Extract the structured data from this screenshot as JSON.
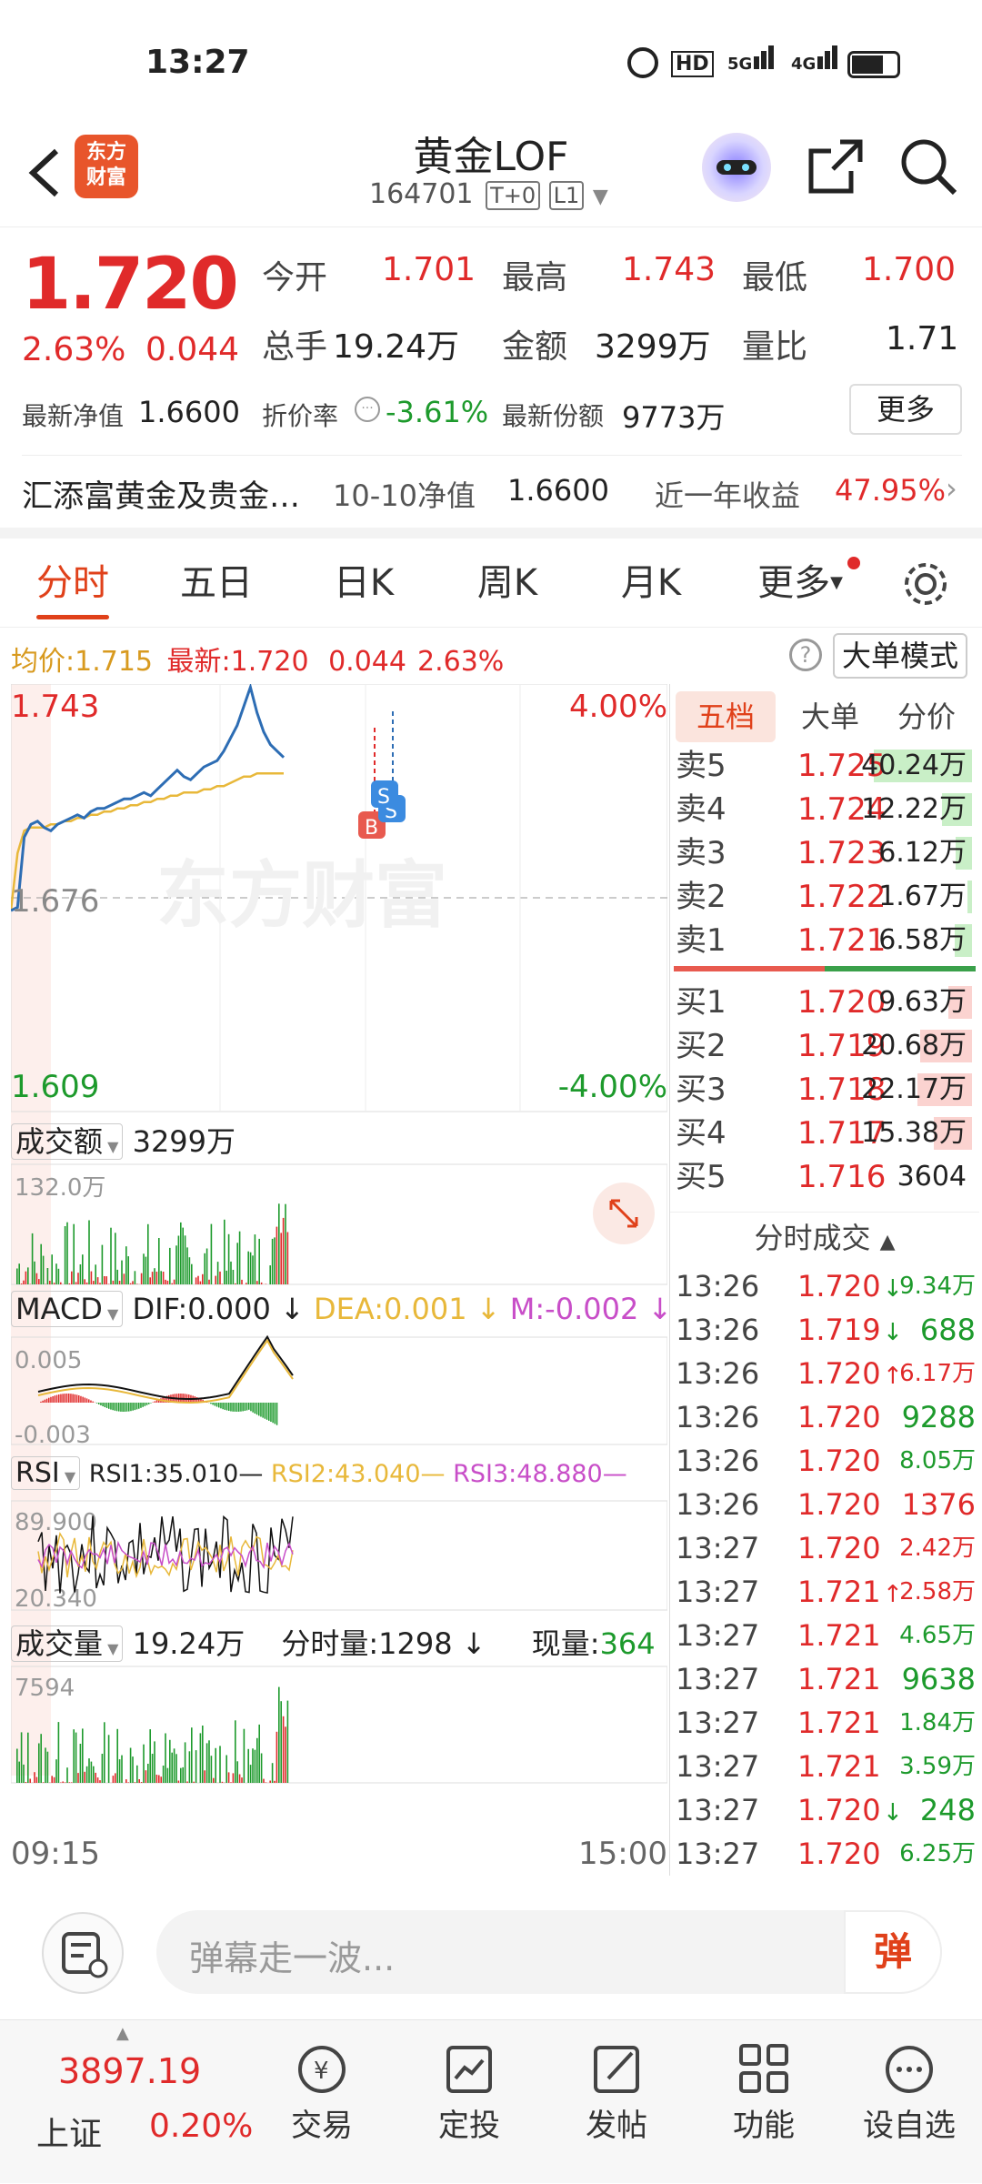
{
  "status": {
    "time": "13:27",
    "net_badge": "HD",
    "sig1": "5G",
    "sig2": "4G"
  },
  "nav": {
    "logo_line1": "东方",
    "logo_line2": "财富",
    "title": "黄金LOF",
    "code": "164701",
    "tag1": "T+0",
    "tag2": "L1"
  },
  "quote": {
    "price": "1.720",
    "pct": "2.63%",
    "chg": "0.044",
    "row1": [
      {
        "label": "今开",
        "value": "1.701"
      },
      {
        "label": "最高",
        "value": "1.743"
      },
      {
        "label": "最低",
        "value": "1.700"
      }
    ],
    "row2": [
      {
        "label": "总手",
        "value": "19.24万"
      },
      {
        "label": "金额",
        "value": "3299万"
      },
      {
        "label": "量比",
        "value": "1.71"
      }
    ],
    "nav_label": "最新净值",
    "nav_value": "1.6600",
    "discount_label": "折价率",
    "discount_value": "-3.61%",
    "share_label": "最新份额",
    "share_value": "9773万",
    "more": "更多",
    "fund_name": "汇添富黄金及贵金…",
    "nav_date_label": "10-10净值",
    "nav_date_value": "1.6600",
    "yield_label": "近一年收益",
    "yield_value": "47.95%"
  },
  "tabs": [
    "分时",
    "五日",
    "日K",
    "周K",
    "月K",
    "更多"
  ],
  "info_bar": {
    "avg_label": "均价:",
    "avg": "1.715",
    "latest_label": "最新:",
    "latest": "1.720",
    "chg": "0.044",
    "pct": "2.63%",
    "mode_btn": "大单模式"
  },
  "chart": {
    "ymax": "1.743",
    "ymid": "1.676",
    "ymin": "1.609",
    "pmax": "4.00%",
    "pmin": "-4.00%",
    "marker_b": "B",
    "marker_s": "S",
    "watermark": "东方财富",
    "price_series": [
      1.672,
      1.673,
      1.695,
      1.699,
      1.7,
      1.698,
      1.697,
      1.699,
      1.7,
      1.701,
      1.702,
      1.701,
      1.703,
      1.704,
      1.704,
      1.705,
      1.706,
      1.707,
      1.707,
      1.708,
      1.709,
      1.708,
      1.71,
      1.712,
      1.714,
      1.716,
      1.714,
      1.713,
      1.715,
      1.717,
      1.718,
      1.719,
      1.722,
      1.726,
      1.73,
      1.736,
      1.742,
      1.734,
      1.728,
      1.724,
      1.722,
      1.72
    ],
    "avg_series": [
      1.672,
      1.69,
      1.697,
      1.698,
      1.698,
      1.698,
      1.699,
      1.699,
      1.7,
      1.7,
      1.701,
      1.701,
      1.702,
      1.702,
      1.703,
      1.703,
      1.704,
      1.704,
      1.705,
      1.705,
      1.706,
      1.706,
      1.707,
      1.707,
      1.708,
      1.708,
      1.709,
      1.709,
      1.709,
      1.71,
      1.71,
      1.711,
      1.711,
      1.712,
      1.713,
      1.714,
      1.714,
      1.715,
      1.715,
      1.715,
      1.715,
      1.715
    ]
  },
  "turnover": {
    "label": "成交额",
    "value": "3299万",
    "axis_max": "132.0万"
  },
  "macd": {
    "label": "MACD",
    "dif": "DIF:0.000",
    "dea": "DEA:0.001",
    "m": "M:-0.002",
    "ymax": "0.005",
    "ymin": "-0.003"
  },
  "rsi": {
    "label": "RSI",
    "rsi1": "RSI1:35.010",
    "rsi2": "RSI2:43.040",
    "rsi3": "RSI3:48.880",
    "ymax": "89.900",
    "ymin": "20.340"
  },
  "volume": {
    "label": "成交量",
    "value": "19.24万",
    "fs_label": "分时量:1298",
    "now_label": "现量:",
    "now_value": "364",
    "axis_max": "7594"
  },
  "time_axis": {
    "start": "09:15",
    "end": "15:00"
  },
  "book": {
    "tabs": [
      "五档",
      "大单",
      "分价"
    ],
    "sells": [
      {
        "label": "卖5",
        "price": "1.725",
        "vol": "40.24万",
        "fill": 0.98
      },
      {
        "label": "卖4",
        "price": "1.724",
        "vol": "12.22万",
        "fill": 0.3
      },
      {
        "label": "卖3",
        "price": "1.723",
        "vol": "6.12万",
        "fill": 0.16
      },
      {
        "label": "卖2",
        "price": "1.722",
        "vol": "1.67万",
        "fill": 0.05
      },
      {
        "label": "卖1",
        "price": "1.721",
        "vol": "6.58万",
        "fill": 0.17
      }
    ],
    "buys": [
      {
        "label": "买1",
        "price": "1.720",
        "vol": "9.63万",
        "fill": 0.24
      },
      {
        "label": "买2",
        "price": "1.719",
        "vol": "20.68万",
        "fill": 0.52
      },
      {
        "label": "买3",
        "price": "1.718",
        "vol": "22.17万",
        "fill": 0.55
      },
      {
        "label": "买4",
        "price": "1.717",
        "vol": "15.38万",
        "fill": 0.38
      },
      {
        "label": "买5",
        "price": "1.716",
        "vol": "3604",
        "fill": 0.0
      }
    ]
  },
  "trades_title": "分时成交",
  "trades": [
    {
      "t": "13:26",
      "p": "1.720",
      "dir": "down",
      "v": "9.34万",
      "vc": "green"
    },
    {
      "t": "13:26",
      "p": "1.719",
      "dir": "down",
      "v": "688",
      "vc": "green"
    },
    {
      "t": "13:26",
      "p": "1.720",
      "dir": "up",
      "v": "6.17万",
      "vc": "red"
    },
    {
      "t": "13:26",
      "p": "1.720",
      "dir": "",
      "v": "9288",
      "vc": "green"
    },
    {
      "t": "13:26",
      "p": "1.720",
      "dir": "",
      "v": "8.05万",
      "vc": "green"
    },
    {
      "t": "13:26",
      "p": "1.720",
      "dir": "",
      "v": "1376",
      "vc": "red"
    },
    {
      "t": "13:27",
      "p": "1.720",
      "dir": "",
      "v": "2.42万",
      "vc": "red"
    },
    {
      "t": "13:27",
      "p": "1.721",
      "dir": "up",
      "v": "2.58万",
      "vc": "red"
    },
    {
      "t": "13:27",
      "p": "1.721",
      "dir": "",
      "v": "4.65万",
      "vc": "green"
    },
    {
      "t": "13:27",
      "p": "1.721",
      "dir": "",
      "v": "9638",
      "vc": "green"
    },
    {
      "t": "13:27",
      "p": "1.721",
      "dir": "",
      "v": "1.84万",
      "vc": "green"
    },
    {
      "t": "13:27",
      "p": "1.721",
      "dir": "",
      "v": "3.59万",
      "vc": "green"
    },
    {
      "t": "13:27",
      "p": "1.720",
      "dir": "down",
      "v": "248",
      "vc": "green"
    },
    {
      "t": "13:27",
      "p": "1.720",
      "dir": "",
      "v": "6.25万",
      "vc": "green"
    }
  ],
  "comment": {
    "placeholder": "弹幕走一波...",
    "danmu_btn": "弹"
  },
  "bottom": {
    "index_value": "3897.19",
    "index_name": "上证",
    "index_pct": "0.20%",
    "items": [
      {
        "label": "交易",
        "icon": "yuan-cycle-icon"
      },
      {
        "label": "定投",
        "icon": "chart-calendar-icon"
      },
      {
        "label": "发帖",
        "icon": "edit-icon"
      },
      {
        "label": "功能",
        "icon": "grid-icon"
      },
      {
        "label": "设自选",
        "icon": "more-dots-icon"
      }
    ]
  },
  "colors": {
    "up": "#e02a2a",
    "down": "#1d9a2c",
    "accent": "#e0411a",
    "line": "#2d6db4",
    "avg": "#e8b83a"
  }
}
